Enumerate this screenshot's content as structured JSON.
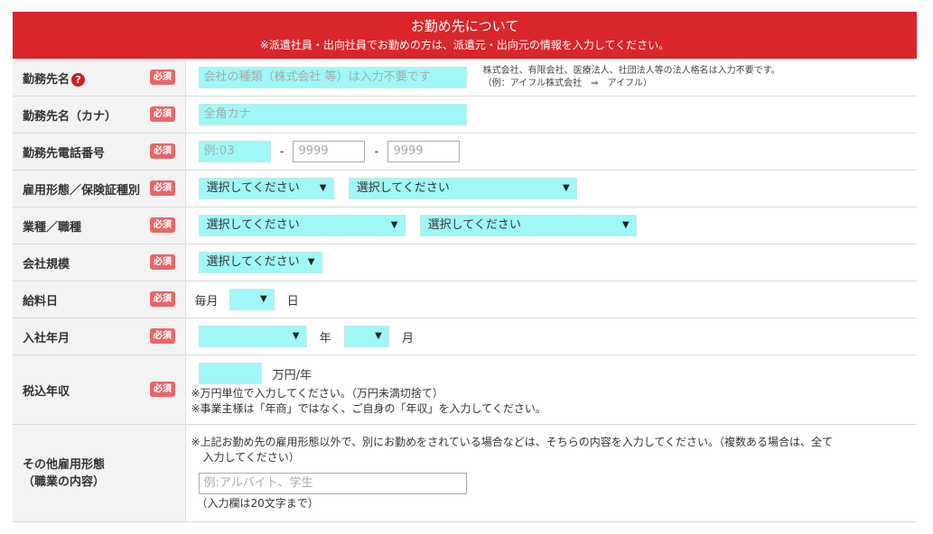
{
  "header": {
    "title": "お勤め先について",
    "subtitle": "※派遣社員・出向社員でお勤めの方は、派遣元・出向元の情報を入力してください。"
  },
  "required_label": "必須",
  "help_icon": "?",
  "rows": {
    "company_name": {
      "label": "勤務先名",
      "placeholder": "会社の種類（株式会社 等）は入力不要です",
      "note1": "株式会社、有限会社、医療法人、社団法人等の法人格名は入力不要です。",
      "note2": "（例：アイフル株式会社　⇒　アイフル）"
    },
    "company_kana": {
      "label": "勤務先名（カナ）",
      "placeholder": "全角カナ"
    },
    "phone": {
      "label": "勤務先電話番号",
      "p1": "例:03",
      "sep": "-",
      "p2": "9999",
      "p3": "9999"
    },
    "employment": {
      "label": "雇用形態／保険証種別",
      "sel1": "選択してください",
      "sel2": "選択してください"
    },
    "industry": {
      "label": "業種／職種",
      "sel1": "選択してください",
      "sel2": "選択してください"
    },
    "company_size": {
      "label": "会社規模",
      "sel1": "選択してください"
    },
    "payday": {
      "label": "給料日",
      "prefix": "毎月",
      "suffix": "日"
    },
    "join_date": {
      "label": "入社年月",
      "year_suffix": "年",
      "month_suffix": "月"
    },
    "income": {
      "label": "税込年収",
      "unit": "万円/年",
      "note1": "※万円単位で入力してください。（万円未満切捨て）",
      "note2": "※事業主様は「年商」ではなく、ご自身の「年収」を入力してください。"
    },
    "other": {
      "label1": "その他雇用形態",
      "label2": "（職業の内容）",
      "note1": "※上記お勤め先の雇用形態以外で、別にお勤めをされている場合などは、そちらの内容を入力してください。（複数ある場合は、全て",
      "note2": "入力してください）",
      "placeholder": "例:アルバイト、学生",
      "limit": "（入力欄は20文字まで）"
    }
  },
  "arrow": "▼"
}
